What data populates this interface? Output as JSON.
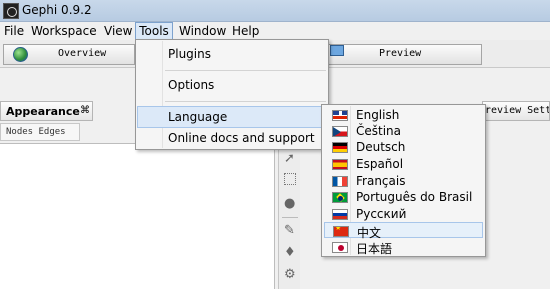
{
  "window": {
    "title": "Gephi 0.9.2"
  },
  "menubar": {
    "items": [
      {
        "label": "File"
      },
      {
        "label": "Workspace"
      },
      {
        "label": "View"
      },
      {
        "label": "Tools"
      },
      {
        "label": "Window"
      },
      {
        "label": "Help"
      }
    ],
    "active": "Tools"
  },
  "workspace_tabs": [
    {
      "label": "Overview",
      "icon": "globe-icon"
    },
    {
      "label": "Preview",
      "icon": "monitor-icon"
    }
  ],
  "tools_menu": {
    "items": [
      {
        "label": "Plugins"
      },
      {
        "label": "Options"
      },
      {
        "label": "Language",
        "has_submenu": true,
        "highlighted": true
      },
      {
        "label": "Online docs and support"
      }
    ]
  },
  "language_menu": {
    "items": [
      {
        "label": "English",
        "flag": "uk-flag-icon"
      },
      {
        "label": "Čeština",
        "flag": "czech-flag-icon"
      },
      {
        "label": "Deutsch",
        "flag": "german-flag-icon"
      },
      {
        "label": "Español",
        "flag": "spanish-flag-icon"
      },
      {
        "label": "Français",
        "flag": "french-flag-icon"
      },
      {
        "label": "Português do Brasil",
        "flag": "brazil-flag-icon"
      },
      {
        "label": "Русский",
        "flag": "russian-flag-icon"
      },
      {
        "label": "中文",
        "flag": "china-flag-icon",
        "highlighted": true
      },
      {
        "label": "日本語",
        "flag": "japan-flag-icon"
      }
    ]
  },
  "appearance_panel": {
    "title": "Appearance",
    "close_glyph": "⌘",
    "sub_tabs": "Nodes Edges"
  },
  "preview_settings_panel": {
    "title": "review Settin"
  }
}
